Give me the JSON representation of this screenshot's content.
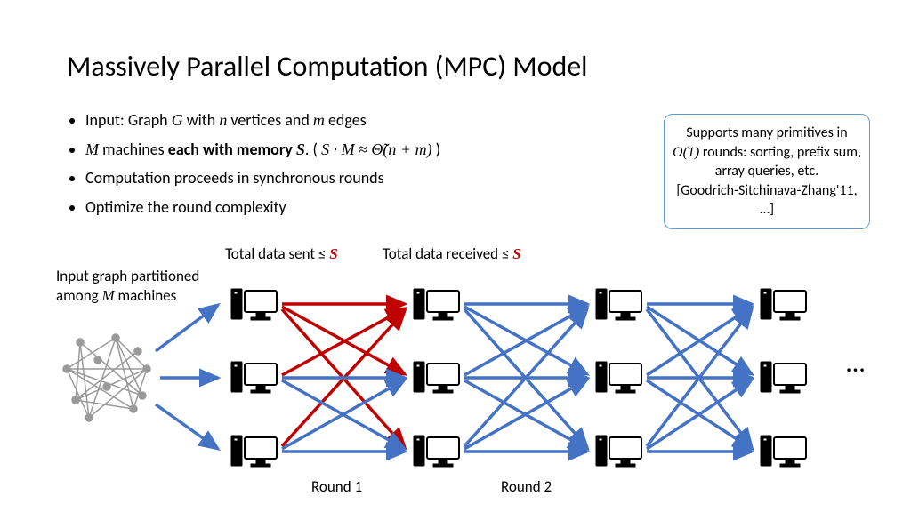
{
  "title": "Massively Parallel Computation (MPC) Model",
  "bullets": {
    "b1a": "Input: Graph ",
    "b1_G": "G",
    "b1b": " with ",
    "b1_n": "n",
    "b1c": " vertices and ",
    "b1_m": "m",
    "b1d": " edges",
    "b2_M": "M",
    "b2a": " machines ",
    "b2bold": "each with memory ",
    "b2_S": "S",
    "b2dot": ".    ( ",
    "b2_expr": "S · M ≈ Θ̃(n + m)",
    "b2end": " )",
    "b3": "Computation proceeds in synchronous rounds",
    "b4": "Optimize the round complexity"
  },
  "callout": {
    "l1a": "Supports many primitives in ",
    "l1_o1": "O(1)",
    "l1b": " rounds: sorting, prefix sum, array queries, etc.",
    "ref": "[Goodrich-Sitchinava-Zhang'11, …]"
  },
  "labels": {
    "input_partition_a": "Input graph partitioned",
    "input_partition_b": "among ",
    "input_partition_M": "M",
    "input_partition_c": " machines",
    "sent": "Total data sent ≤ ",
    "recv": "Total data received ≤ ",
    "S": "S",
    "round1": "Round 1",
    "round2": "Round 2",
    "dots": "…"
  }
}
